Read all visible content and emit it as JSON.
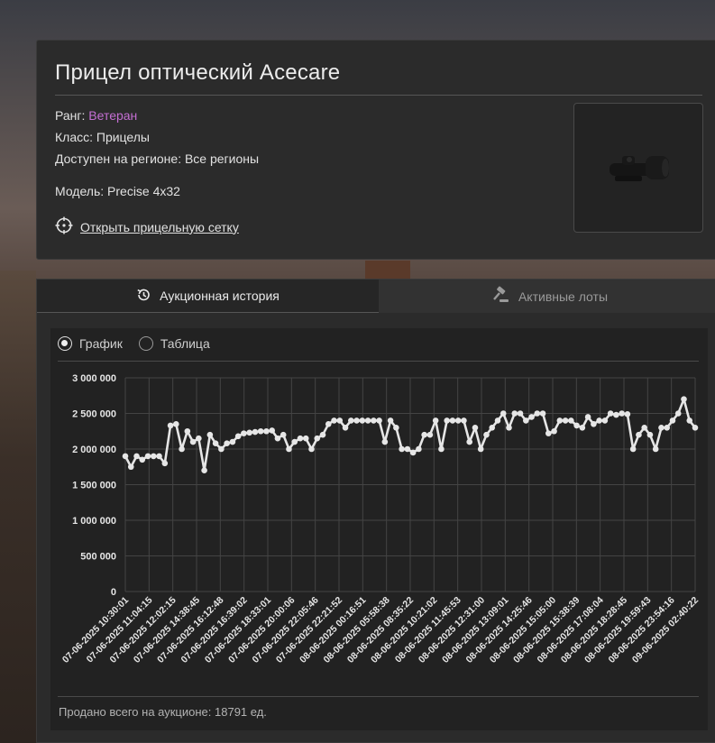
{
  "item": {
    "title": "Прицел оптический Acecare",
    "rank_label": "Ранг:",
    "rank_value": "Ветеран",
    "rank_color": "#c46fd3",
    "class_text": "Класс: Прицелы",
    "region_text": "Доступен на регионе: Все регионы",
    "model_text": "Модель: Precise 4x32",
    "reticle_link": "Открыть прицельную сетку",
    "reticle_icon": "crosshair-icon"
  },
  "tabs": [
    {
      "label": "Аукционная история",
      "icon": "history-icon",
      "active": true
    },
    {
      "label": "Активные лоты",
      "icon": "gavel-icon",
      "active": false
    }
  ],
  "view_toggle": {
    "options": [
      "График",
      "Таблица"
    ],
    "selected": "График"
  },
  "footer": {
    "sold_total": "Продано всего на аукционе: 18791 ед."
  },
  "chart_data": {
    "type": "line",
    "ylim": [
      0,
      3000000
    ],
    "yticks": [
      "0",
      "500 000",
      "1 000 000",
      "1 500 000",
      "2 000 000",
      "2 500 000",
      "3 000 000"
    ],
    "grid": true,
    "color": "#e6e6e6",
    "xtick_labels": [
      "07-06-2025 10:30:01",
      "07-06-2025 11:04:15",
      "07-06-2025 12:02:15",
      "07-06-2025 14:38:45",
      "07-06-2025 16:12:48",
      "07-06-2025 16:39:02",
      "07-06-2025 18:33:01",
      "07-06-2025 20:00:06",
      "07-06-2025 22:05:46",
      "07-06-2025 22:21:52",
      "08-06-2025 00:16:51",
      "08-06-2025 05:58:38",
      "08-06-2025 08:35:22",
      "08-06-2025 10:21:02",
      "08-06-2025 11:45:53",
      "08-06-2025 12:31:00",
      "08-06-2025 13:09:01",
      "08-06-2025 14:25:46",
      "08-06-2025 15:05:00",
      "08-06-2025 15:38:39",
      "08-06-2025 17:08:04",
      "08-06-2025 18:28:45",
      "08-06-2025 19:59:43",
      "08-06-2025 23:54:16",
      "09-06-2025 02:40:22"
    ],
    "values": [
      1900000,
      1750000,
      1900000,
      1850000,
      1900000,
      1900000,
      1900000,
      1800000,
      2330000,
      2350000,
      2000000,
      2250000,
      2100000,
      2150000,
      1700000,
      2200000,
      2080000,
      2000000,
      2080000,
      2100000,
      2180000,
      2220000,
      2230000,
      2240000,
      2250000,
      2250000,
      2260000,
      2150000,
      2200000,
      2000000,
      2100000,
      2150000,
      2150000,
      2000000,
      2150000,
      2200000,
      2350000,
      2400000,
      2400000,
      2300000,
      2400000,
      2400000,
      2400000,
      2400000,
      2400000,
      2400000,
      2100000,
      2400000,
      2300000,
      2000000,
      2000000,
      1950000,
      2000000,
      2200000,
      2200000,
      2400000,
      2000000,
      2400000,
      2400000,
      2400000,
      2400000,
      2100000,
      2300000,
      2000000,
      2200000,
      2300000,
      2400000,
      2500000,
      2300000,
      2500000,
      2500000,
      2400000,
      2450000,
      2500000,
      2500000,
      2220000,
      2250000,
      2400000,
      2400000,
      2400000,
      2330000,
      2300000,
      2450000,
      2350000,
      2400000,
      2400000,
      2500000,
      2480000,
      2500000,
      2490000,
      2000000,
      2200000,
      2300000,
      2200000,
      2000000,
      2300000,
      2300000,
      2400000,
      2500000,
      2700000,
      2400000,
      2300000
    ]
  }
}
